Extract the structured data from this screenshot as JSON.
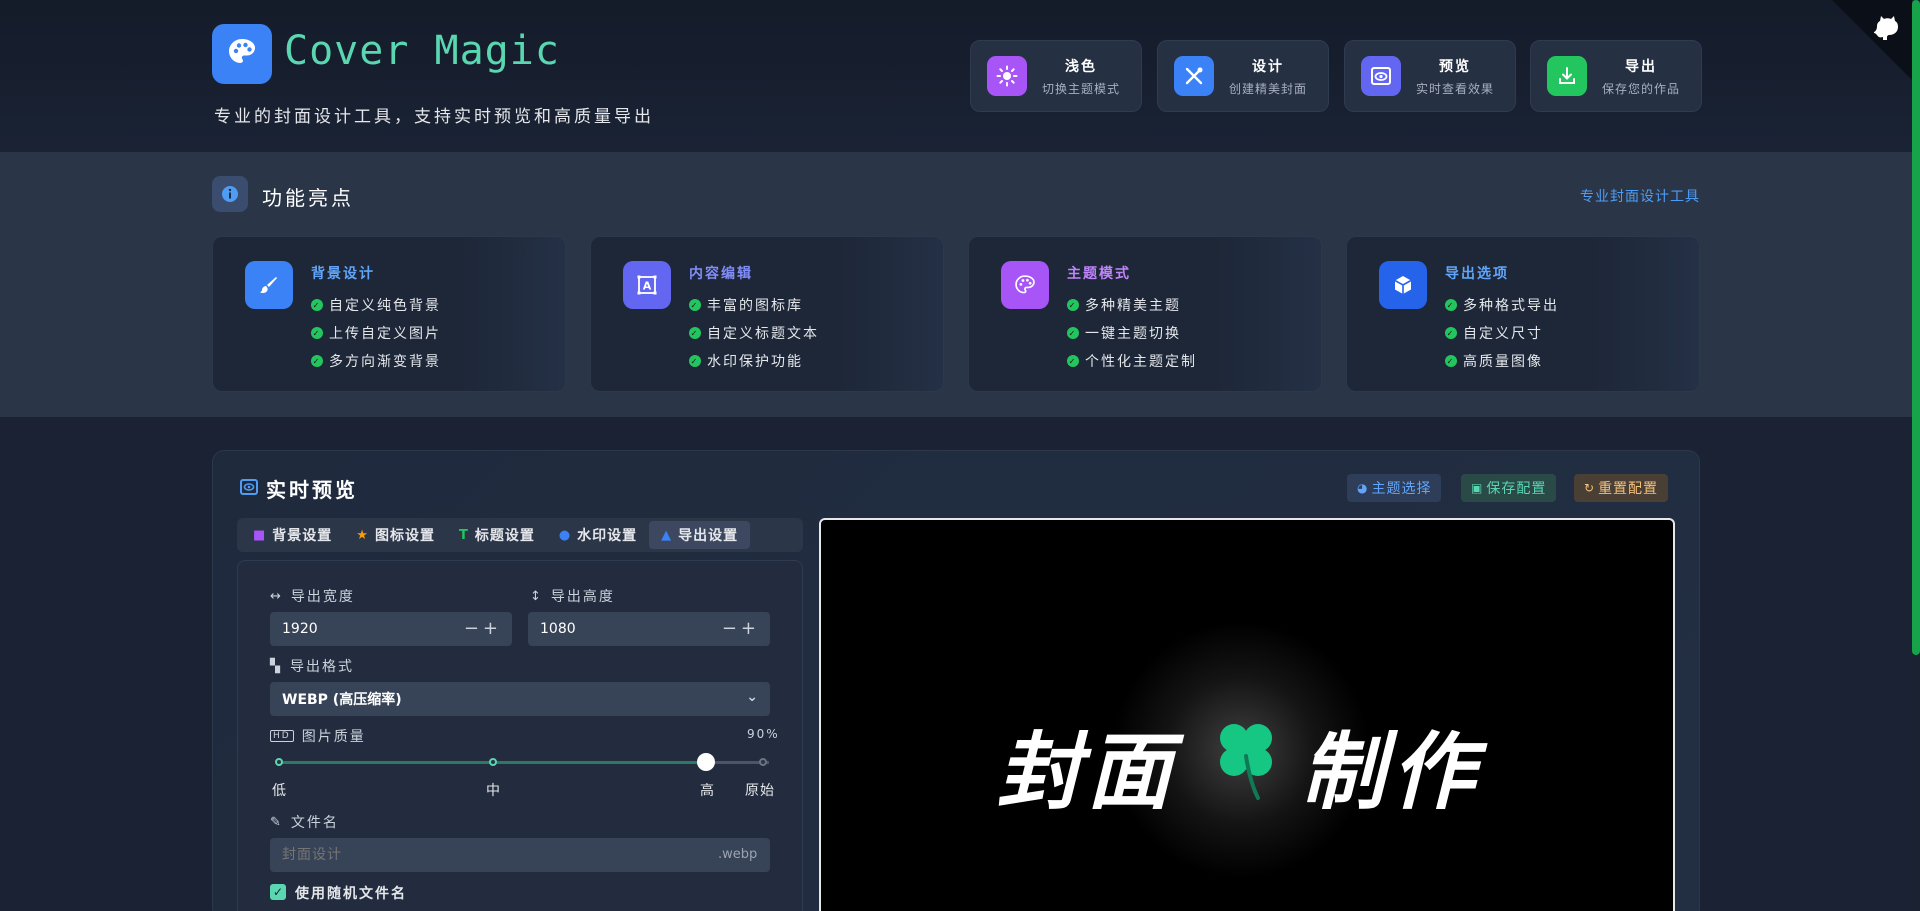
{
  "brand": {
    "title": "Cover Magic",
    "subtitle": "专业的封面设计工具，支持实时预览和高质量导出",
    "icon": "palette-icon"
  },
  "top_buttons": [
    {
      "label": "浅色",
      "desc": "切换主题模式",
      "icon": "sun-icon",
      "color": "#a855f7"
    },
    {
      "label": "设计",
      "desc": "创建精美封面",
      "icon": "design-tools-icon",
      "color": "#3b82f6"
    },
    {
      "label": "预览",
      "desc": "实时查看效果",
      "icon": "eye-icon",
      "color": "#6366f1"
    },
    {
      "label": "导出",
      "desc": "保存您的作品",
      "icon": "download-icon",
      "color": "#22c55e"
    }
  ],
  "features": {
    "title": "功能亮点",
    "link": "专业封面设计工具",
    "cards": [
      {
        "title": "背景设计",
        "color": "#60a5fa",
        "icon": "brush-icon",
        "icon_bg": "#3b82f6",
        "items": [
          "自定义纯色背景",
          "上传自定义图片",
          "多方向渐变背景"
        ]
      },
      {
        "title": "内容编辑",
        "color": "#818cf8",
        "icon": "text-frame-icon",
        "icon_bg": "#6366f1",
        "items": [
          "丰富的图标库",
          "自定义标题文本",
          "水印保护功能"
        ]
      },
      {
        "title": "主题模式",
        "color": "#c084fc",
        "icon": "palette-icon",
        "icon_bg": "#a855f7",
        "items": [
          "多种精美主题",
          "一键主题切换",
          "个性化主题定制"
        ]
      },
      {
        "title": "导出选项",
        "color": "#60a5fa",
        "icon": "cube-icon",
        "icon_bg": "#2563eb",
        "items": [
          "多种格式导出",
          "自定义尺寸",
          "高质量图像"
        ]
      }
    ]
  },
  "preview_panel": {
    "title": "实时预览",
    "buttons": [
      {
        "label": "主题选择",
        "icon": "palette-icon",
        "color": "#60a5fa",
        "bg": "#2f3e58"
      },
      {
        "label": "保存配置",
        "icon": "save-icon",
        "color": "#5ad6b0",
        "bg": "#2a4a48"
      },
      {
        "label": "重置配置",
        "icon": "reset-icon",
        "color": "#f5c07a",
        "bg": "#4a3f34"
      }
    ],
    "tabs": [
      {
        "label": "背景设置",
        "icon": "square-icon",
        "color": "#a855f7"
      },
      {
        "label": "图标设置",
        "icon": "star-icon",
        "color": "#f59e0b"
      },
      {
        "label": "标题设置",
        "icon": "text-icon",
        "color": "#22c55e"
      },
      {
        "label": "水印设置",
        "icon": "droplet-icon",
        "color": "#3b82f6"
      },
      {
        "label": "导出设置",
        "icon": "export-icon",
        "color": "#3b82f6"
      }
    ],
    "active_tab": 4
  },
  "export_settings": {
    "width_label": "导出宽度",
    "width_value": "1920",
    "height_label": "导出高度",
    "height_value": "1080",
    "format_label": "导出格式",
    "format_value": "WEBP (高压缩率)",
    "quality_label": "图片质量",
    "quality_value": "90%",
    "quality_fraction": 0.9,
    "quality_ticks": [
      "低",
      "中",
      "高",
      "原始"
    ],
    "filename_label": "文件名",
    "filename_placeholder": "封面设计",
    "filename_ext": ".webp",
    "random_name_label": "使用随机文件名",
    "random_name_checked": true
  },
  "cover": {
    "left_text": "封面",
    "right_text": "制作",
    "icon": "clover-icon",
    "icon_color": "#16c784",
    "background": "#000000"
  }
}
